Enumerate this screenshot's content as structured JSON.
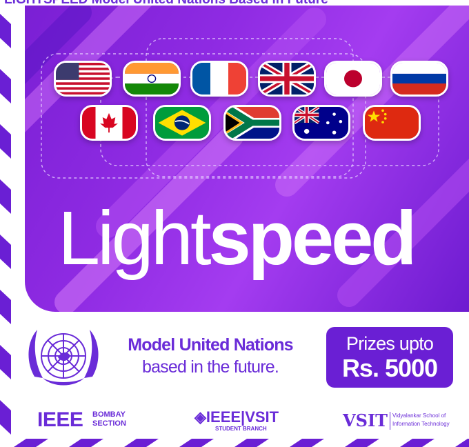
{
  "caption": "LIGHTSPEED Model United Nations Based in Future",
  "hero": {
    "wordmark_light": "Light",
    "wordmark_bold": "speed",
    "flags": [
      "usa-flag",
      "india-flag",
      "france-flag",
      "uk-flag",
      "japan-flag",
      "russia-flag",
      "canada-flag",
      "brazil-flag",
      "south-africa-flag",
      "australia-flag",
      "china-flag"
    ]
  },
  "event": {
    "title": "Model United Nations",
    "subtitle": "based in the future."
  },
  "prize": {
    "line1": "Prizes upto",
    "line2": "Rs. 5000"
  },
  "logos": {
    "ieee_bombay_main": "IEEE",
    "ieee_bombay_line1": "BOMBAY",
    "ieee_bombay_line2": "SECTION",
    "ieee_vsit_main": "◈IEEE|VSIT",
    "ieee_vsit_sub": "STUDENT BRANCH",
    "vsit_main": "VSIT",
    "vsit_line1": "Vidyalankar School of",
    "vsit_line2": "Information Technology"
  },
  "colors": {
    "brand_purple": "#6a2cd8",
    "hero_purple": "#8f2be3",
    "prize_badge": "#6a1fd4"
  }
}
